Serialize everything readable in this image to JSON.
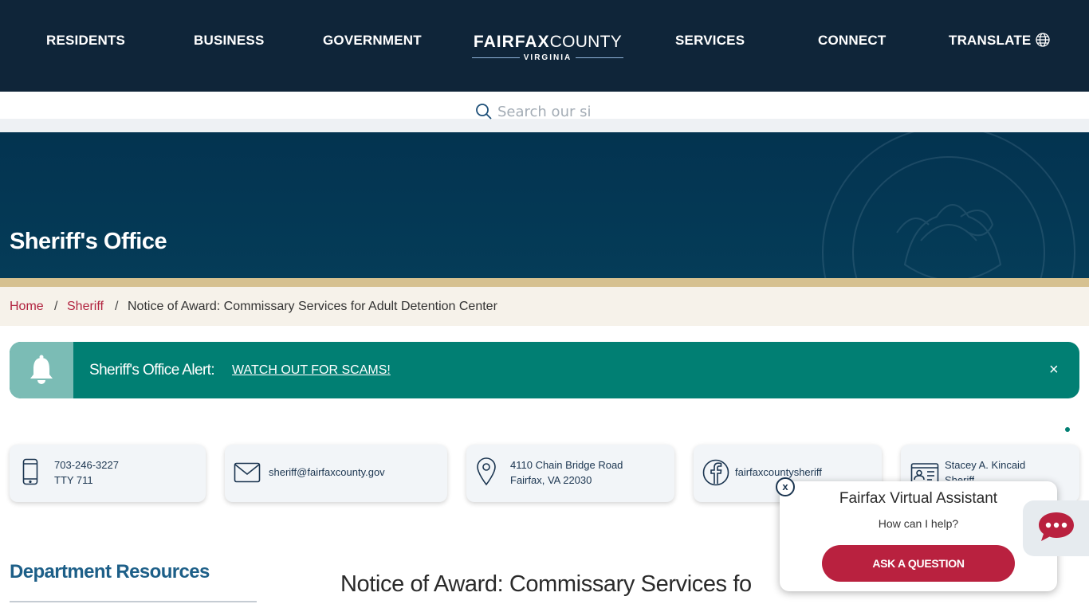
{
  "nav": {
    "residents": "RESIDENTS",
    "business": "BUSINESS",
    "government": "GOVERNMENT",
    "services": "SERVICES",
    "connect": "CONNECT",
    "translate": "TRANSLATE"
  },
  "logo": {
    "fairfax": "FAIRFAX",
    "county": "COUNTY",
    "virginia": "VIRGINIA"
  },
  "search": {
    "placeholder": "Search our si"
  },
  "hero": {
    "title": "Sheriff's Office"
  },
  "breadcrumb": {
    "home": "Home",
    "sep": "/",
    "sheriff": "Sheriff",
    "current": "Notice of Award: Commissary Services for Adult Detention Center"
  },
  "alert": {
    "title": "Sheriff's Office Alert:",
    "link": "WATCH OUT FOR SCAMS!",
    "close": "×"
  },
  "contacts": {
    "phone": "703-246-3227",
    "tty": "TTY 711",
    "email": "sheriff@fairfaxcounty.gov",
    "address1": "4110 Chain Bridge Road",
    "address2": "Fairfax, VA 22030",
    "facebook": "fairfaxcountysheriff",
    "person_name": "Stacey A. Kincaid",
    "person_title": "Sheriff"
  },
  "sidebar": {
    "title": "Department Resources"
  },
  "main": {
    "heading": "Notice of Award: Commissary Services fo"
  },
  "assistant": {
    "title": "Fairfax Virtual Assistant",
    "subtitle": "How can I help?",
    "button": "ASK A QUESTION",
    "close": "x"
  },
  "colors": {
    "nav_bg": "#0f2539",
    "hero_bg": "#033350",
    "gold": "#d6c190",
    "alert_bg": "#017f73",
    "link_red": "#b1233f",
    "cta_red": "#b9213f",
    "dept_blue": "#1d5f88"
  }
}
